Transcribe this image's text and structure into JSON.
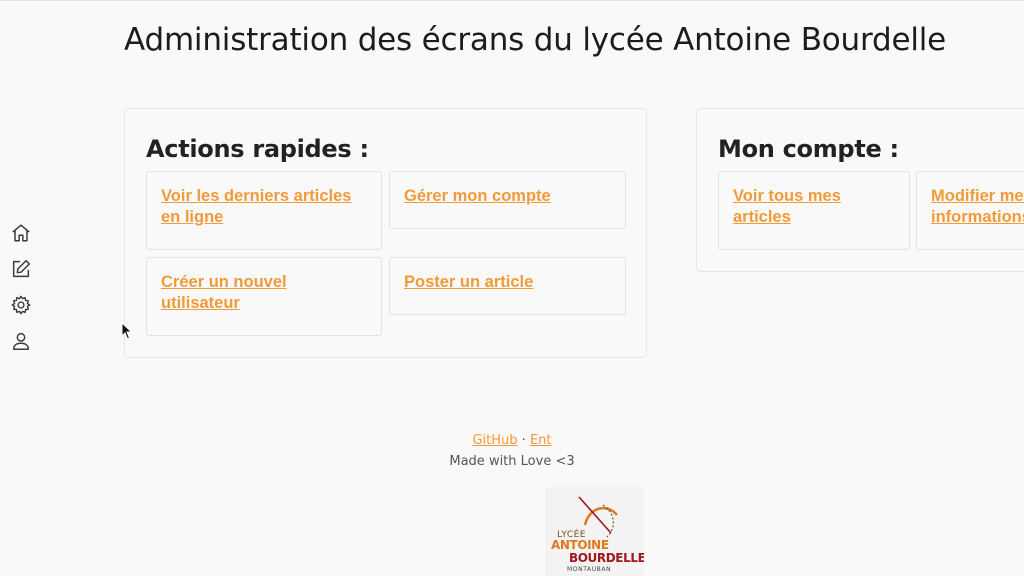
{
  "page": {
    "title": "Administration des écrans du lycée Antoine Bourdelle"
  },
  "sidebar": {
    "items": [
      {
        "icon": "home-icon"
      },
      {
        "icon": "edit-icon"
      },
      {
        "icon": "gear-icon"
      },
      {
        "icon": "user-icon"
      }
    ]
  },
  "quick_actions": {
    "title": "Actions rapides :",
    "links": [
      "Voir les derniers articles en ligne",
      "Gérer mon compte",
      "Créer un nouvel utilisateur",
      "Poster un article"
    ]
  },
  "account": {
    "title": "Mon compte :",
    "links": [
      "Voir tous mes articles",
      "Modifier mes informations"
    ]
  },
  "footer": {
    "github": "GitHub",
    "separator": "·",
    "ent": "Ent",
    "tagline": "Made with Love <3"
  },
  "logo": {
    "line1": "LYCÉE",
    "line2": "ANTOINE",
    "line3": "BOURDELLE",
    "line4": "MONTAUBAN"
  },
  "colors": {
    "link": "#f29a38",
    "background": "#f9f9fa",
    "border": "#e6e6ea"
  }
}
